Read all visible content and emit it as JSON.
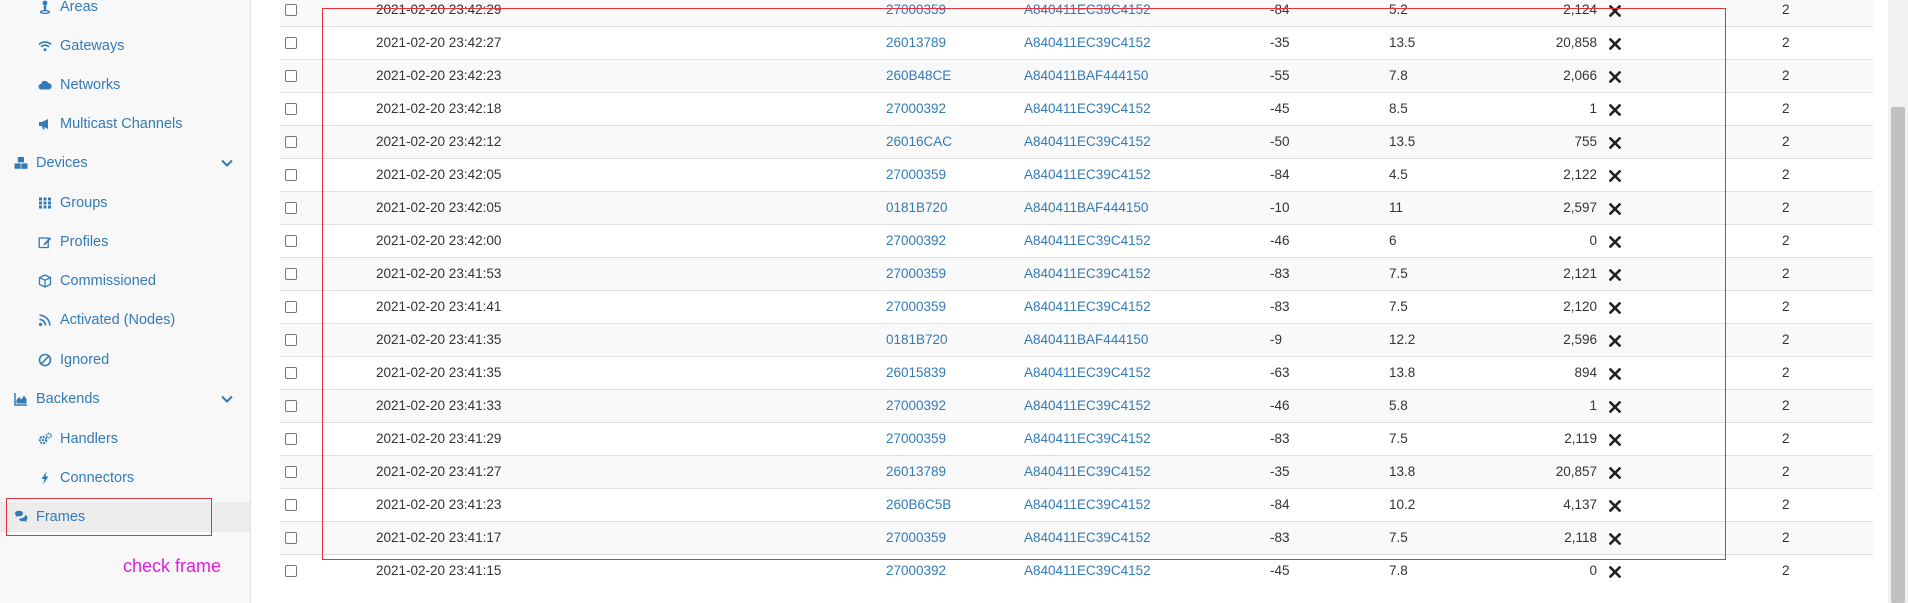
{
  "sidebar": {
    "items": [
      {
        "label": "Areas",
        "icon": "person-pin-icon",
        "level": "sub"
      },
      {
        "label": "Gateways",
        "icon": "wifi-icon",
        "level": "sub"
      },
      {
        "label": "Networks",
        "icon": "cloud-icon",
        "level": "sub"
      },
      {
        "label": "Multicast Channels",
        "icon": "bullhorn-icon",
        "level": "sub"
      },
      {
        "label": "Devices",
        "icon": "cubes-icon",
        "level": "group",
        "expanded": true
      },
      {
        "label": "Groups",
        "icon": "grid-icon",
        "level": "sub"
      },
      {
        "label": "Profiles",
        "icon": "edit-icon",
        "level": "sub"
      },
      {
        "label": "Commissioned",
        "icon": "cube-icon",
        "level": "sub"
      },
      {
        "label": "Activated (Nodes)",
        "icon": "rss-icon",
        "level": "sub"
      },
      {
        "label": "Ignored",
        "icon": "ban-icon",
        "level": "sub"
      },
      {
        "label": "Backends",
        "icon": "area-chart-icon",
        "level": "group",
        "expanded": true
      },
      {
        "label": "Handlers",
        "icon": "cogs-icon",
        "level": "sub"
      },
      {
        "label": "Connectors",
        "icon": "bolt-icon",
        "level": "sub"
      },
      {
        "label": "Frames",
        "icon": "comments-icon",
        "level": "group",
        "active": true
      }
    ],
    "annotation": "check frame"
  },
  "colors": {
    "link": "#337ab7",
    "highlight_box": "#e8303a",
    "annotation": "#e01ce0"
  },
  "table": {
    "rows": [
      {
        "time": "2021-02-20 23:42:29",
        "device": "27000359",
        "gateway": "A840411EC39C4152",
        "rssi": "-84",
        "snr": "5.2",
        "fcnt": "2,124",
        "last": "2"
      },
      {
        "time": "2021-02-20 23:42:27",
        "device": "26013789",
        "gateway": "A840411EC39C4152",
        "rssi": "-35",
        "snr": "13.5",
        "fcnt": "20,858",
        "last": "2"
      },
      {
        "time": "2021-02-20 23:42:23",
        "device": "260B48CE",
        "gateway": "A840411BAF444150",
        "rssi": "-55",
        "snr": "7.8",
        "fcnt": "2,066",
        "last": "2"
      },
      {
        "time": "2021-02-20 23:42:18",
        "device": "27000392",
        "gateway": "A840411EC39C4152",
        "rssi": "-45",
        "snr": "8.5",
        "fcnt": "1",
        "last": "2"
      },
      {
        "time": "2021-02-20 23:42:12",
        "device": "26016CAC",
        "gateway": "A840411EC39C4152",
        "rssi": "-50",
        "snr": "13.5",
        "fcnt": "755",
        "last": "2"
      },
      {
        "time": "2021-02-20 23:42:05",
        "device": "27000359",
        "gateway": "A840411EC39C4152",
        "rssi": "-84",
        "snr": "4.5",
        "fcnt": "2,122",
        "last": "2"
      },
      {
        "time": "2021-02-20 23:42:05",
        "device": "0181B720",
        "gateway": "A840411BAF444150",
        "rssi": "-10",
        "snr": "11",
        "fcnt": "2,597",
        "last": "2"
      },
      {
        "time": "2021-02-20 23:42:00",
        "device": "27000392",
        "gateway": "A840411EC39C4152",
        "rssi": "-46",
        "snr": "6",
        "fcnt": "0",
        "last": "2"
      },
      {
        "time": "2021-02-20 23:41:53",
        "device": "27000359",
        "gateway": "A840411EC39C4152",
        "rssi": "-83",
        "snr": "7.5",
        "fcnt": "2,121",
        "last": "2"
      },
      {
        "time": "2021-02-20 23:41:41",
        "device": "27000359",
        "gateway": "A840411EC39C4152",
        "rssi": "-83",
        "snr": "7.5",
        "fcnt": "2,120",
        "last": "2"
      },
      {
        "time": "2021-02-20 23:41:35",
        "device": "0181B720",
        "gateway": "A840411BAF444150",
        "rssi": "-9",
        "snr": "12.2",
        "fcnt": "2,596",
        "last": "2"
      },
      {
        "time": "2021-02-20 23:41:35",
        "device": "26015839",
        "gateway": "A840411EC39C4152",
        "rssi": "-63",
        "snr": "13.8",
        "fcnt": "894",
        "last": "2"
      },
      {
        "time": "2021-02-20 23:41:33",
        "device": "27000392",
        "gateway": "A840411EC39C4152",
        "rssi": "-46",
        "snr": "5.8",
        "fcnt": "1",
        "last": "2"
      },
      {
        "time": "2021-02-20 23:41:29",
        "device": "27000359",
        "gateway": "A840411EC39C4152",
        "rssi": "-83",
        "snr": "7.5",
        "fcnt": "2,119",
        "last": "2"
      },
      {
        "time": "2021-02-20 23:41:27",
        "device": "26013789",
        "gateway": "A840411EC39C4152",
        "rssi": "-35",
        "snr": "13.8",
        "fcnt": "20,857",
        "last": "2"
      },
      {
        "time": "2021-02-20 23:41:23",
        "device": "260B6C5B",
        "gateway": "A840411EC39C4152",
        "rssi": "-84",
        "snr": "10.2",
        "fcnt": "4,137",
        "last": "2"
      },
      {
        "time": "2021-02-20 23:41:17",
        "device": "27000359",
        "gateway": "A840411EC39C4152",
        "rssi": "-83",
        "snr": "7.5",
        "fcnt": "2,118",
        "last": "2"
      },
      {
        "time": "2021-02-20 23:41:15",
        "device": "27000392",
        "gateway": "A840411EC39C4152",
        "rssi": "-45",
        "snr": "7.8",
        "fcnt": "0",
        "last": "2"
      }
    ]
  }
}
